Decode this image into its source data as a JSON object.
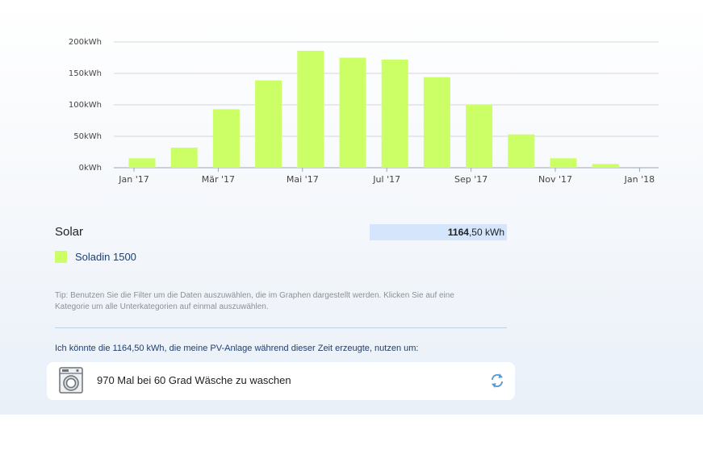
{
  "chart_data": {
    "type": "bar",
    "title": "",
    "xlabel": "",
    "ylabel": "",
    "unit": "kWh",
    "ylim": [
      0,
      200
    ],
    "yticks": [
      {
        "value": 0,
        "label": "0kWh"
      },
      {
        "value": 50,
        "label": "50kWh"
      },
      {
        "value": 100,
        "label": "100kWh"
      },
      {
        "value": 150,
        "label": "150kWh"
      },
      {
        "value": 200,
        "label": "200kWh"
      }
    ],
    "xticks": [
      {
        "index": 0,
        "label": "Jan '17"
      },
      {
        "index": 2,
        "label": "Mär '17"
      },
      {
        "index": 4,
        "label": "Mai '17"
      },
      {
        "index": 6,
        "label": "Jul '17"
      },
      {
        "index": 8,
        "label": "Sep '17"
      },
      {
        "index": 10,
        "label": "Nov '17"
      },
      {
        "index": 12,
        "label": "Jan '18"
      }
    ],
    "grid": true,
    "color": "#ccff66",
    "categories": [
      "Jan '17",
      "Feb '17",
      "Mär '17",
      "Apr '17",
      "Mai '17",
      "Jun '17",
      "Jul '17",
      "Aug '17",
      "Sep '17",
      "Okt '17",
      "Nov '17",
      "Dez '17"
    ],
    "series": [
      {
        "name": "Soladin 1500",
        "values": [
          15,
          32,
          93,
          139,
          186,
          175,
          172,
          144,
          100,
          53,
          15,
          6
        ]
      }
    ]
  },
  "summary": {
    "title": "Solar",
    "total_int": "1164",
    "total_dec": ",50",
    "total_unit": " kWh",
    "legend_label": "Soladin 1500",
    "legend_color": "#ccff66",
    "tip": "Tip: Benutzen Sie die Filter um die Daten auszuwählen, die im Graphen dargestellt werden. Klicken Sie auf eine Kategorie um alle Unterkategorien auf einmal auszuwählen."
  },
  "usage": {
    "intro": "Ich könnte die 1164,50 kWh, die meine PV-Anlage während dieser Zeit erzeugte, nutzen um:",
    "item_text": "970 Mal bei 60 Grad Wäsche zu waschen",
    "item_icon": "washing-machine-icon",
    "refresh_icon": "refresh-icon"
  }
}
